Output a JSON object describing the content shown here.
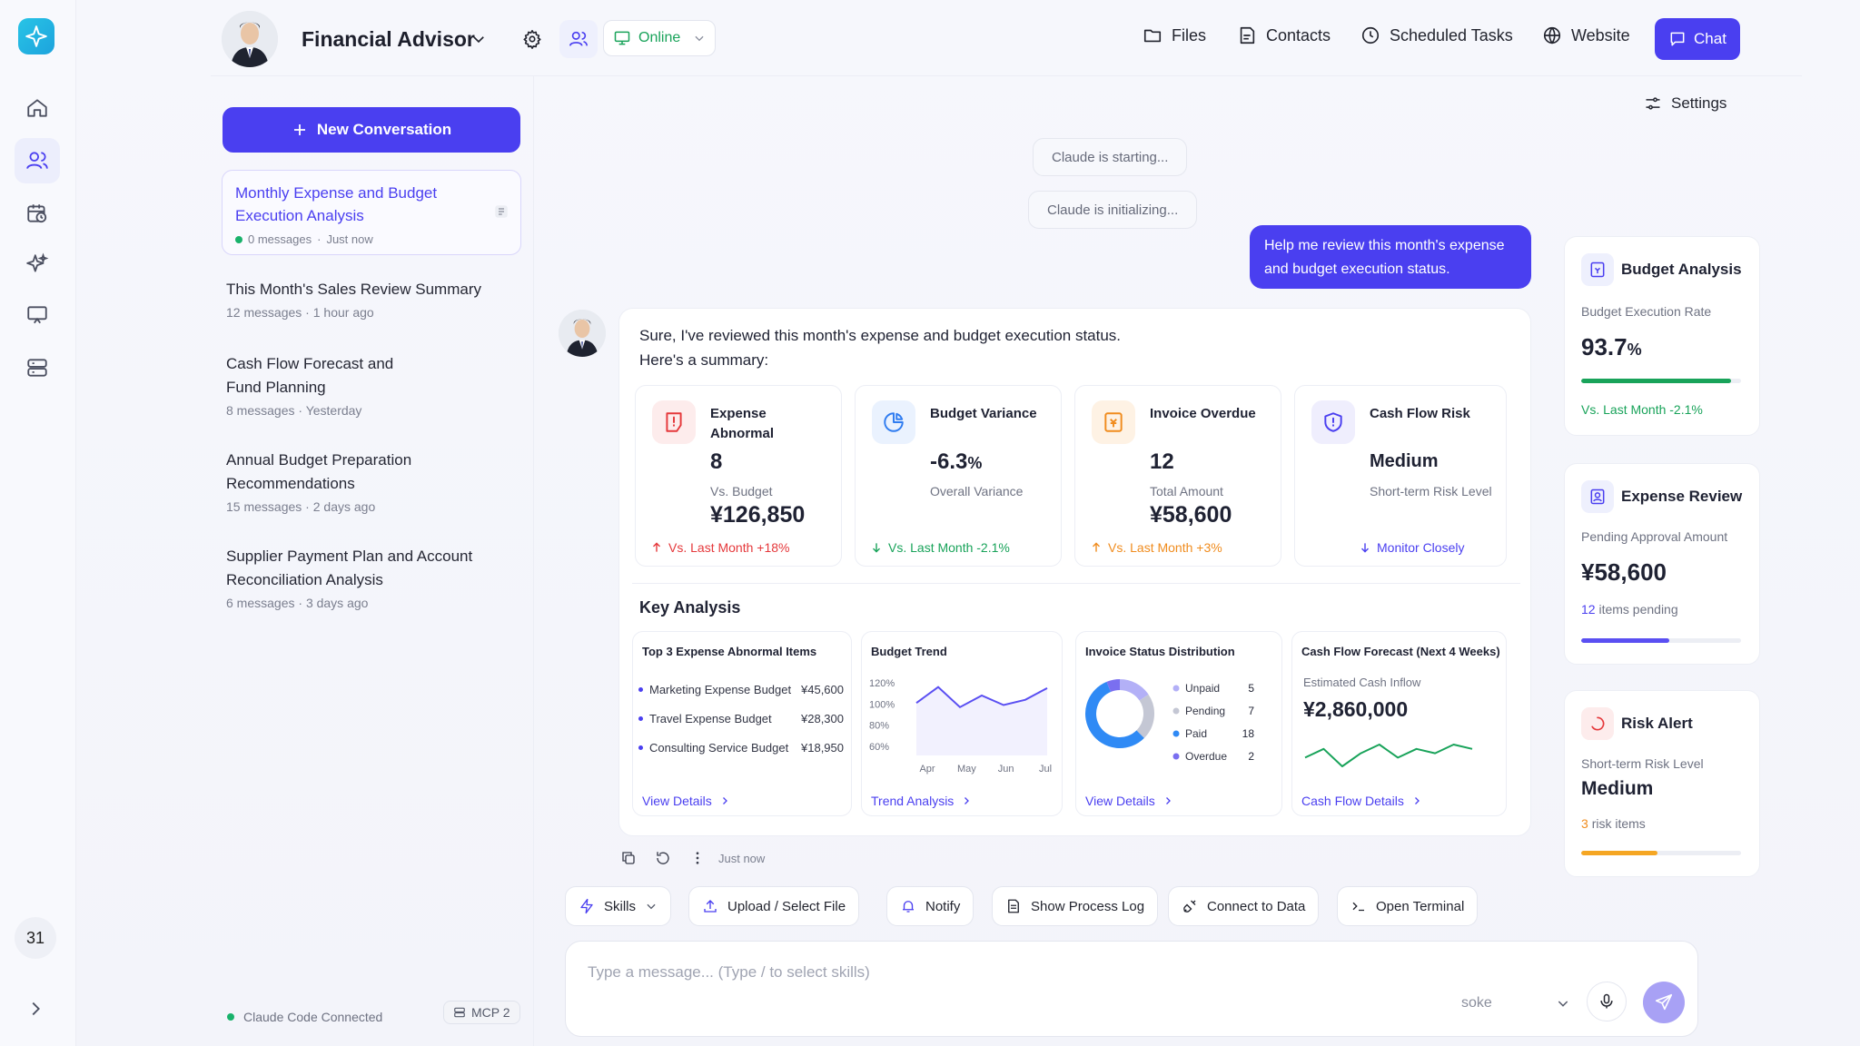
{
  "rail": {
    "date": "31"
  },
  "header": {
    "agent_name": "Financial Advisor",
    "status": "Online",
    "nav": [
      {
        "label": "Files",
        "icon": "folder-icon"
      },
      {
        "label": "Contacts",
        "icon": "contacts-icon"
      },
      {
        "label": "Scheduled Tasks",
        "icon": "clock-icon"
      },
      {
        "label": "Website",
        "icon": "globe-icon"
      }
    ],
    "chat_label": "Chat"
  },
  "sidebar": {
    "new_conversation": "New Conversation",
    "conversations": [
      {
        "title": "Monthly Expense and Budget Execution Analysis",
        "count": "0 messages",
        "time": "Just now",
        "active": true
      },
      {
        "title": "This Month's Sales Review Summary",
        "count": "12 messages",
        "time": "1 hour ago"
      },
      {
        "title": "Cash Flow Forecast and Fund Planning",
        "count": "8 messages",
        "time": "Yesterday"
      },
      {
        "title": "Annual Budget Preparation Recommendations",
        "count": "15 messages",
        "time": "2 days ago"
      },
      {
        "title": "Supplier Payment Plan and Account Reconciliation Analysis",
        "count": "6 messages",
        "time": "3 days ago"
      }
    ],
    "separator": "·",
    "connection_status": "Claude Code Connected",
    "mcp_label": "MCP 2"
  },
  "chat": {
    "settings_label": "Settings",
    "system_messages": [
      "Claude is starting...",
      "Claude is initializing..."
    ],
    "user_message": "Help me review this month's expense and budget execution status.",
    "assistant_intro_line1": "Sure, I've reviewed this month's expense and budget execution status.",
    "assistant_intro_line2": "Here's a summary:",
    "stats": [
      {
        "title": "Expense Abnormal",
        "value": "8",
        "sub": "Vs. Budget",
        "amount": "¥126,850",
        "footer": "Vs. Last Month +18%",
        "trend": "up",
        "color": "#e5383b"
      },
      {
        "title": "Budget Variance",
        "value": "-6.3",
        "value_suffix": "%",
        "sub": "Overall Variance",
        "footer": "Vs. Last Month -2.1%",
        "trend": "down",
        "color": "#19a35a"
      },
      {
        "title": "Invoice Overdue",
        "value": "12",
        "sub": "Total Amount",
        "amount": "¥58,600",
        "footer": "Vs. Last Month +3%",
        "trend": "up",
        "color": "#f08c1e"
      },
      {
        "title": "Cash Flow Risk",
        "value": "Medium",
        "sub": "Short-term Risk Level",
        "footer": "Monitor Closely",
        "trend": "down",
        "color": "#4a3ff0"
      }
    ],
    "key_analysis": {
      "title": "Key Analysis",
      "top_expenses": {
        "title": "Top 3 Expense Abnormal Items",
        "items": [
          {
            "name": "Marketing Expense Budget",
            "value": "¥45,600"
          },
          {
            "name": "Travel Expense Budget",
            "value": "¥28,300"
          },
          {
            "name": "Consulting Service Budget",
            "value": "¥18,950"
          }
        ],
        "link": "View Details"
      },
      "budget_trend": {
        "title": "Budget Trend",
        "link": "Trend Analysis"
      },
      "invoice_status": {
        "title": "Invoice Status Distribution",
        "link": "View Details"
      },
      "cash_flow": {
        "title": "Cash Flow Forecast (Next 4 Weeks)",
        "label": "Estimated Cash Inflow",
        "value": "¥2,860,000",
        "link": "Cash Flow Details"
      }
    },
    "message_time": "Just now",
    "toolbar": [
      {
        "label": "Skills",
        "icon": "bolt-icon"
      },
      {
        "label": "Upload / Select File",
        "icon": "upload-icon"
      },
      {
        "label": "Notify",
        "icon": "bell-icon"
      },
      {
        "label": "Show Process Log",
        "icon": "log-icon"
      },
      {
        "label": "Connect to Data",
        "icon": "plug-icon"
      },
      {
        "label": "Open Terminal",
        "icon": "terminal-icon"
      }
    ],
    "input_placeholder": "Type a message... (Type / to select skills)",
    "model": "soke"
  },
  "side_cards": {
    "budget": {
      "title": "Budget Analysis",
      "label": "Budget Execution Rate",
      "value": "93.7",
      "value_suffix": "%",
      "note": "Vs. Last Month -2.1%",
      "progress": 0.937
    },
    "expense": {
      "title": "Expense Review",
      "label": "Pending Approval Amount",
      "value": "¥58,600",
      "count": "12",
      "count_label": "items pending",
      "progress": 0.55
    },
    "risk": {
      "title": "Risk Alert",
      "label": "Short-term Risk Level",
      "value": "Medium",
      "count": "3",
      "count_label": "risk items",
      "progress": 0.48
    }
  },
  "chart_data": [
    {
      "type": "line",
      "title": "Budget Trend",
      "categories": [
        "Apr",
        "May",
        "Jun",
        "Jul"
      ],
      "y_ticks": [
        "120%",
        "100%",
        "80%",
        "60%"
      ],
      "series": [
        {
          "values": [
            101,
            116,
            97,
            108,
            99,
            104,
            115
          ]
        }
      ],
      "ylim": [
        60,
        120
      ],
      "color": "#5a4ff2"
    },
    {
      "type": "pie",
      "title": "Invoice Status Distribution",
      "labels": [
        "Unpaid",
        "Pending",
        "Paid",
        "Overdue"
      ],
      "values": [
        5,
        7,
        18,
        2
      ],
      "colors": [
        "#b3b0f7",
        "#c4c7d4",
        "#2f8af5",
        "#7a6ff0"
      ]
    },
    {
      "type": "line",
      "title": "Cash Flow Forecast (Next 4 Weeks)",
      "series": [
        {
          "values": [
            4,
            6,
            2,
            5,
            7,
            4,
            6,
            5,
            7,
            6
          ]
        }
      ],
      "color": "#19a35a"
    }
  ]
}
